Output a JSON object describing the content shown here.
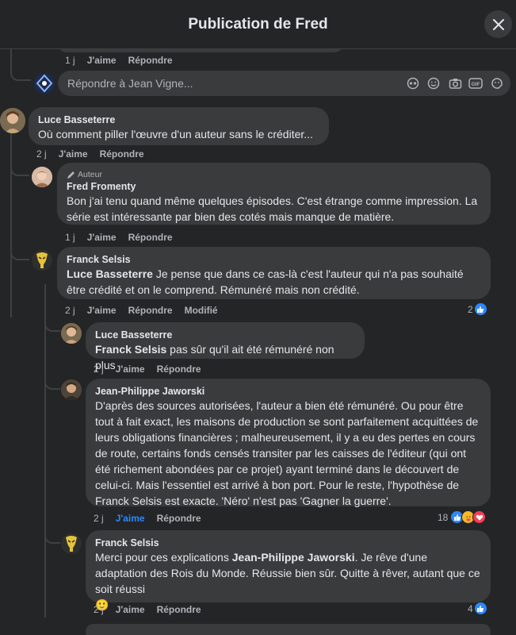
{
  "header": {
    "title": "Publication de Fred"
  },
  "top_prev": {
    "time": "1 j",
    "like": "J'aime",
    "reply": "Répondre"
  },
  "reply_box": {
    "placeholder": "Répondre à Jean Vigne..."
  },
  "comments": [
    {
      "author": "Luce Basseterre",
      "text": "Où comment piller l'œuvre d'un auteur sans le créditer...",
      "time": "2 j",
      "like": "J'aime",
      "reply": "Répondre"
    },
    {
      "badge": "Auteur",
      "author": "Fred Fromenty",
      "text": "Bon j'ai tenu quand même quelques épisodes. C'est étrange comme impression. La série est intéressante par bien des cotés mais manque de matière.",
      "time": "1 j",
      "like": "J'aime",
      "reply": "Répondre"
    },
    {
      "author": "Franck Selsis",
      "mention": "Luce Basseterre",
      "text": " Je pense que dans ce cas-là c'est l'auteur qui n'a pas souhaité être crédité et on le comprend. Rémunéré mais non crédité.",
      "time": "2 j",
      "like": "J'aime",
      "reply": "Répondre",
      "edited": "Modifié",
      "reactions": "2"
    },
    {
      "author": "Luce Basseterre",
      "mention": "Franck Selsis",
      "text": " pas sûr qu'il ait été rémunéré non plus",
      "time": "2 j",
      "like": "J'aime",
      "reply": "Répondre"
    },
    {
      "author": "Jean-Philippe Jaworski",
      "text": "D'après des sources autorisées, l'auteur a bien été rémunéré. Ou pour être tout à fait exact, les maisons de production se sont parfaitement acquittées de leurs obligations financières ; malheureusement, il y a eu des pertes en cours de route, certains fonds censés transiter par les caisses de l'éditeur (qui ont été richement abondées par ce projet) ayant terminé dans le découvert de celui-ci. Mais l'essentiel est arrivé à bon port. Pour le reste, l'hypothèse de Franck Selsis est exacte. 'Néro' n'est pas 'Gagner la guerre'.",
      "time": "2 j",
      "like": "J'aime",
      "reply": "Répondre",
      "reactions": "18"
    },
    {
      "author": "Franck Selsis",
      "text_before": "Merci pour ces explications ",
      "mention": "Jean-Philippe Jaworski",
      "text_after": ". Je rêve d'une adaptation des Rois du Monde. Réussie bien sûr. Quitte à rêver, autant que ce soit réussi",
      "emoji": "🙂",
      "time": "2 j",
      "like": "J'aime",
      "reply": "Répondre",
      "reactions": "4"
    }
  ],
  "colors": {
    "background": "#242526",
    "bubble": "#3a3b3c",
    "text": "#e4e6eb",
    "secondary": "#b0b3b8",
    "accent": "#2d88ff"
  }
}
